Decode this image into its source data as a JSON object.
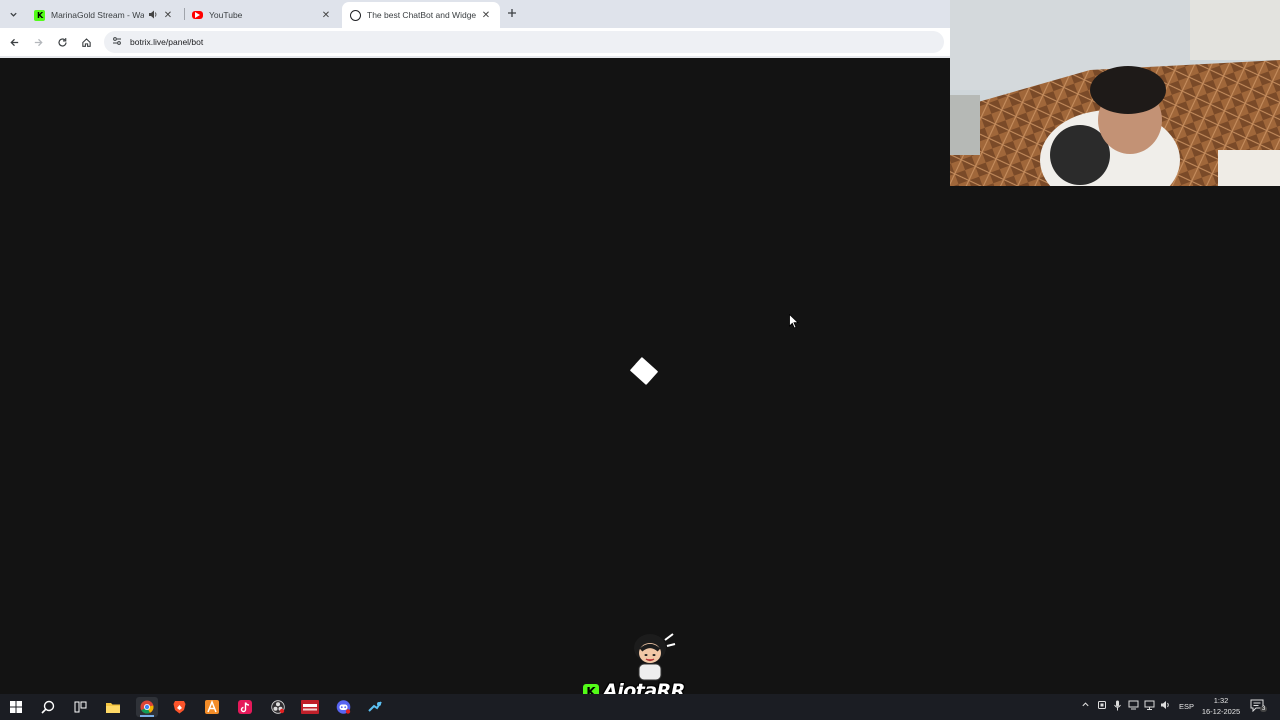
{
  "browser": {
    "tabs": [
      {
        "title": "MarinaGold Stream - Watch",
        "favicon_color": "#53fc18",
        "audio": true,
        "active": false
      },
      {
        "title": "YouTube",
        "favicon_color": "#ff0000",
        "audio": false,
        "active": false
      },
      {
        "title": "The best ChatBot and Widgets",
        "favicon_color": "#202124",
        "audio": false,
        "active": true
      }
    ],
    "url": "botrix.live/panel/bot"
  },
  "overlay": {
    "streamer_name": "AjotaRR",
    "platform_badge": "K"
  },
  "taskbar": {
    "apps": [
      "start-icon",
      "search-icon",
      "task-view-icon",
      "file-explorer-icon",
      "chrome-icon",
      "brave-icon",
      "app-a-icon",
      "tiktok-icon",
      "obs-icon",
      "voicemeeter-icon",
      "discord-icon",
      "steam-icon"
    ],
    "language": "ESP",
    "time": "1:32",
    "date": "16-12-2025",
    "notification_count": "3"
  }
}
